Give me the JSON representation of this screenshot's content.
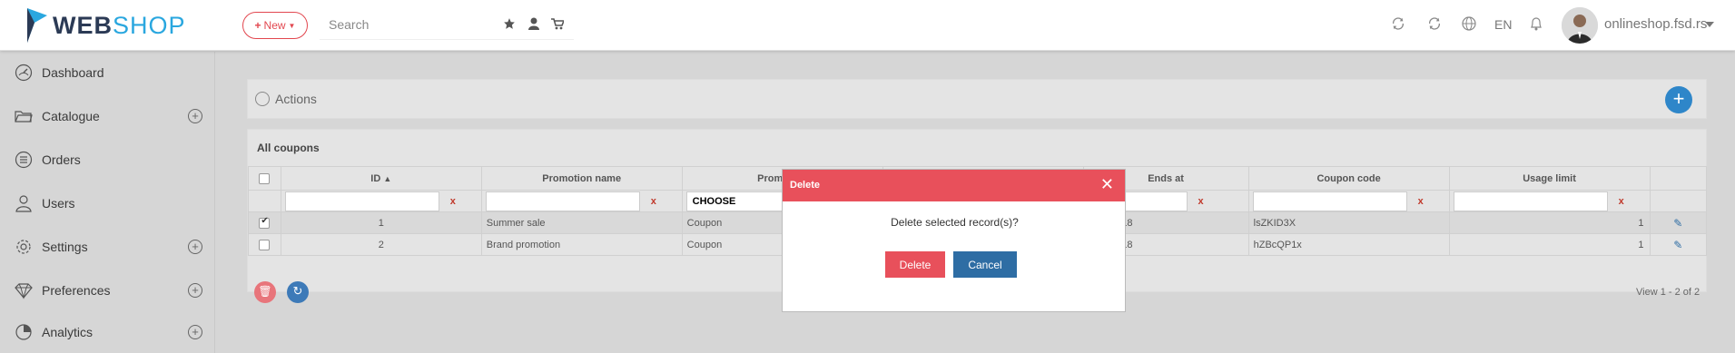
{
  "header": {
    "logo": {
      "part1": "WEB",
      "part2": "SHOP"
    },
    "new_button": "New",
    "search_placeholder": "Search",
    "language": "EN",
    "username": "onlineshop.fsd.rs"
  },
  "sidebar": {
    "items": [
      {
        "label": "Dashboard",
        "icon": "dashboard-icon",
        "expandable": false
      },
      {
        "label": "Catalogue",
        "icon": "folder-icon",
        "expandable": true
      },
      {
        "label": "Orders",
        "icon": "list-icon",
        "expandable": false
      },
      {
        "label": "Users",
        "icon": "user-icon",
        "expandable": false
      },
      {
        "label": "Settings",
        "icon": "gear-icon",
        "expandable": true
      },
      {
        "label": "Preferences",
        "icon": "diamond-icon",
        "expandable": true
      },
      {
        "label": "Analytics",
        "icon": "pie-chart-icon",
        "expandable": true
      }
    ]
  },
  "actions": {
    "label": "Actions"
  },
  "grid": {
    "title": "All coupons",
    "columns": [
      "ID",
      "Promotion name",
      "Promotion",
      "Ends at",
      "Coupon code",
      "Usage limit"
    ],
    "filter_choose": "CHOOSE",
    "clear_label": "x",
    "rows": [
      {
        "id": "1",
        "promotion_name": "Summer sale",
        "promotion": "Coupon",
        "ends_at": "30.8.2018",
        "coupon_code": "lsZKID3X",
        "usage_limit": "1",
        "checked": true
      },
      {
        "id": "2",
        "promotion_name": "Brand promotion",
        "promotion": "Coupon",
        "ends_at": "30.8.2018",
        "coupon_code": "hZBcQP1x",
        "usage_limit": "1",
        "checked": false
      }
    ],
    "pager": "View 1 - 2 of 2"
  },
  "modal": {
    "title": "Delete",
    "message": "Delete selected record(s)?",
    "delete_label": "Delete",
    "cancel_label": "Cancel"
  },
  "colors": {
    "accent_red": "#e8505b",
    "accent_blue": "#2e6da4",
    "brand_dark": "#2b3a55",
    "brand_light": "#2aa7df"
  }
}
